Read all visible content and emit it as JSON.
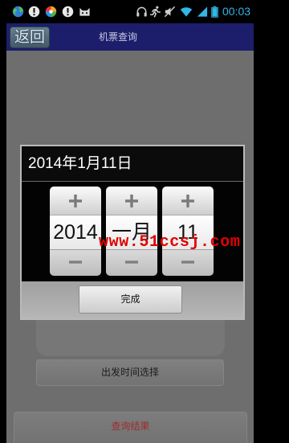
{
  "status_bar": {
    "time": "00:03",
    "battery_level": 1,
    "accent_color": "#33b5e5",
    "left_icons": [
      "globe-icon",
      "alert-icon",
      "pinwheel-icon",
      "alert-icon",
      "android-icon"
    ],
    "right_icons": [
      "headphones-icon",
      "running-icon",
      "silent-mode-icon",
      "wifi-icon",
      "signal-icon",
      "battery-icon"
    ]
  },
  "title_bar": {
    "back_label": "返回",
    "title": "机票查询",
    "background_color": "#1c1e6c"
  },
  "dialog": {
    "title": "2014年1月11日",
    "picker": {
      "increment_icon": "plus-icon",
      "decrement_icon": "minus-icon",
      "year": {
        "value": "2014"
      },
      "month": {
        "value": "一月"
      },
      "day": {
        "value": "11"
      }
    },
    "done_label": "完成"
  },
  "form": {
    "departure_time_label": "出发时间选择",
    "query_results_label": "查询结果",
    "query_results_color": "#9c2d2d"
  },
  "watermark": {
    "text": "www.51ccsj.com",
    "color": "#e00000"
  }
}
